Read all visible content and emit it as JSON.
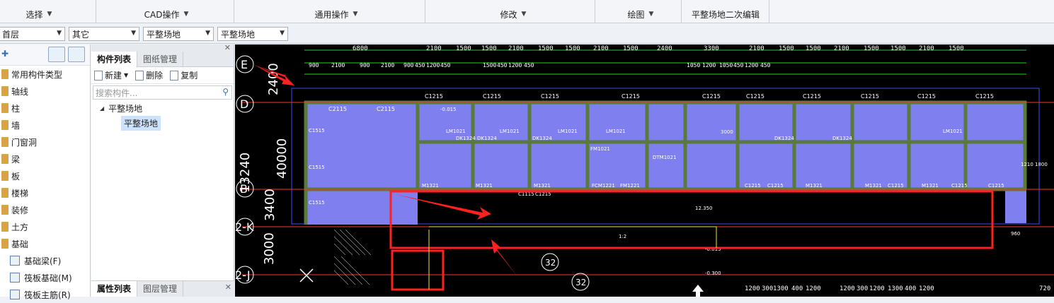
{
  "ribbon": {
    "groups": [
      {
        "label": "选择"
      },
      {
        "label": "CAD操作"
      },
      {
        "label": "通用操作"
      },
      {
        "label": "修改"
      },
      {
        "label": "绘图"
      },
      {
        "label": "平整场地二次编辑"
      }
    ]
  },
  "selectors": [
    {
      "value": "首层"
    },
    {
      "value": "其它"
    },
    {
      "value": "平整场地"
    },
    {
      "value": "平整场地"
    }
  ],
  "left_panel": {
    "items": [
      {
        "label": "常用构件类型"
      },
      {
        "label": "轴线"
      },
      {
        "label": "柱"
      },
      {
        "label": "墙"
      },
      {
        "label": "门窗洞"
      },
      {
        "label": "梁"
      },
      {
        "label": "板"
      },
      {
        "label": "楼梯"
      },
      {
        "label": "装修"
      },
      {
        "label": "土方"
      },
      {
        "label": "基础"
      }
    ],
    "sub_items": [
      {
        "label": "基础梁(F)"
      },
      {
        "label": "筏板基础(M)"
      },
      {
        "label": "筏板主筋(R)"
      }
    ]
  },
  "mid_panel": {
    "tabs": [
      "构件列表",
      "图纸管理"
    ],
    "toolbar": {
      "new": "新建",
      "delete": "删除",
      "copy": "复制"
    },
    "search_placeholder": "搜索构件...",
    "tree_root": "平整场地",
    "tree_leaf": "平整场地",
    "bottom_tabs": [
      "属性列表",
      "图层管理"
    ]
  },
  "cad": {
    "axis_labels": [
      "E",
      "D",
      "B",
      "2-K",
      "2-J"
    ],
    "vertical_dims": [
      "2400",
      "13240",
      "3400",
      "40000",
      "3000",
      "3400"
    ],
    "top_dims": [
      "6800",
      "2100",
      "1500",
      "1500",
      "2100",
      "1500",
      "1500",
      "2100",
      "1500",
      "2400",
      "3300",
      "2100",
      "1500",
      "1500",
      "2100",
      "1500",
      "1500",
      "2100",
      "1500"
    ],
    "top_dims2": [
      "900",
      "2100",
      "900",
      "2100",
      "900",
      "450",
      "1200",
      "450",
      "1500",
      "450",
      "1200",
      "450",
      "1050",
      "1200",
      "1050",
      "450",
      "1200",
      "450"
    ],
    "room_labels": [
      "C2115",
      "C2115",
      "C1215",
      "C1215",
      "C1215",
      "C1215",
      "C1215",
      "C1215",
      "C1215",
      "C1215",
      "C1215",
      "C1215"
    ],
    "door_labels": [
      "LM1021",
      "DK1324",
      "DK1324",
      "LM1021",
      "LM1021",
      "DK1324",
      "LM1021",
      "FM1021",
      "DTM1021",
      "DK1324",
      "DK1324",
      "LM1021"
    ],
    "misc_labels": [
      "C1515",
      "C1515",
      "C1515",
      "M1321",
      "M1321",
      "M1321",
      "FCM1221",
      "FM1221",
      "C1215",
      "C1215",
      "M1321",
      "M1321",
      "C1215",
      "M1321",
      "C1215",
      "C1215",
      "C1115",
      "C1215",
      "960",
      "1800",
      "1210",
      "3000",
      "1:2",
      "12.350",
      "-0.015",
      "-0.300",
      "-0.015"
    ],
    "bottom_dims": [
      "1200",
      "300",
      "1300",
      "400",
      "1200",
      "1200",
      "300",
      "1200",
      "1300",
      "400",
      "1200",
      "720"
    ],
    "annotations": [
      "32",
      "32"
    ],
    "colors": {
      "room_fill": "#7f7ff0",
      "wall": "#5a7a3a",
      "axis": "#ff3030",
      "dim": "#20d020",
      "annotation": "#ff2020"
    }
  }
}
